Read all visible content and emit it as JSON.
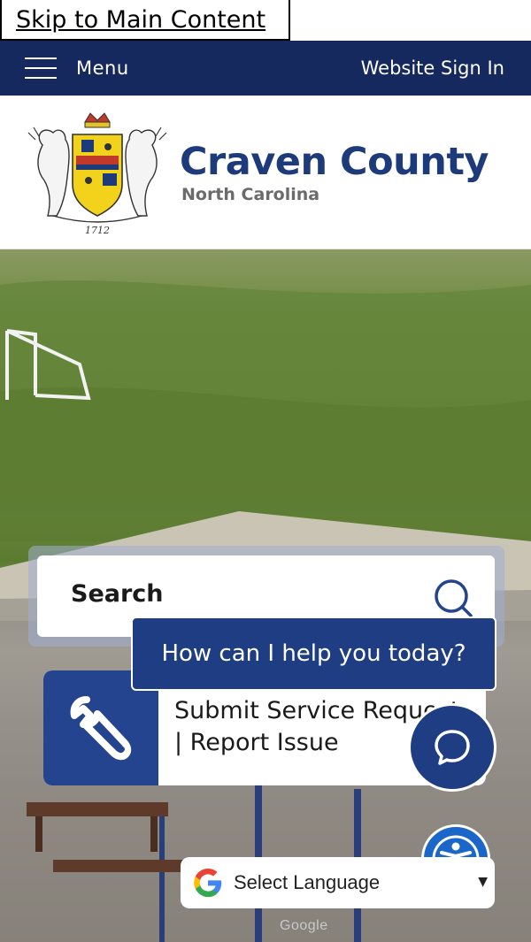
{
  "skip_link": "Skip to Main Content",
  "topbar": {
    "menu_label": "Menu",
    "sign_in_label": "Website Sign In"
  },
  "header": {
    "title": "Craven County",
    "subtitle": "North Carolina",
    "crest_year": "1712"
  },
  "search": {
    "label": "Search"
  },
  "service_request": {
    "line1": "Submit Service Request",
    "line2": "| Report Issue"
  },
  "chat": {
    "prompt": "How can I help you today?"
  },
  "translate": {
    "select_label": "Select Language",
    "powered_by": "Google"
  },
  "colors": {
    "navy": "#16295f",
    "brand_blue": "#1d3a7a",
    "service_blue": "#24448f",
    "accessibility_blue": "#1a66c9"
  },
  "icons": {
    "menu": "hamburger-icon",
    "search": "search-icon",
    "service": "wrench-icon",
    "chat": "chat-icon",
    "accessibility": "accessibility-icon",
    "translate": "google-icon"
  }
}
